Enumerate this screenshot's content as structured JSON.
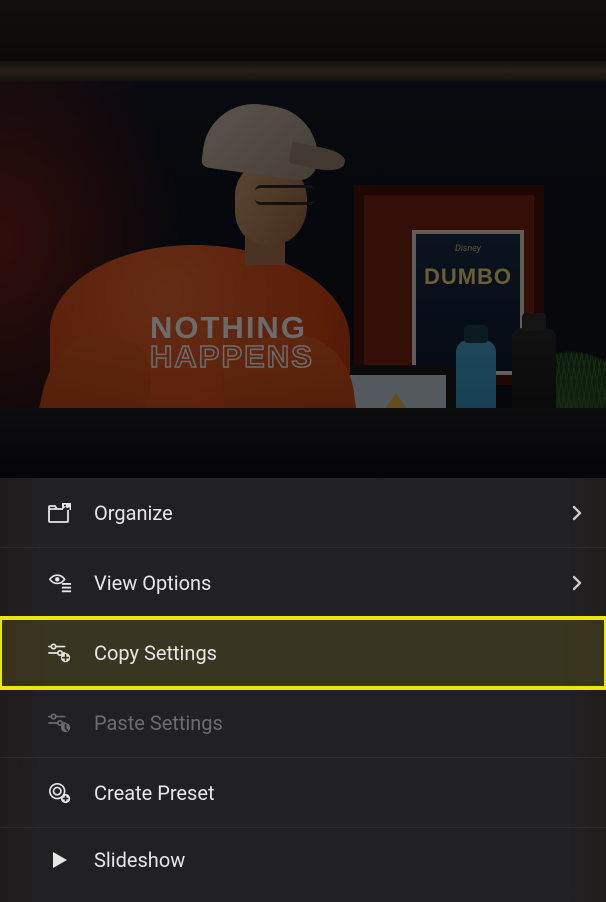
{
  "photo": {
    "sweater_line1": "NOTHING",
    "sweater_line2": "HAPPENS",
    "poster_brand": "Disney",
    "poster_title": "DUMBO"
  },
  "menu": {
    "items": [
      {
        "label": "Organize",
        "has_chevron": true,
        "disabled": false,
        "highlighted": false,
        "icon": "organize-icon"
      },
      {
        "label": "View Options",
        "has_chevron": true,
        "disabled": false,
        "highlighted": false,
        "icon": "view-options-icon"
      },
      {
        "label": "Copy Settings",
        "has_chevron": false,
        "disabled": false,
        "highlighted": true,
        "icon": "sliders-add-icon"
      },
      {
        "label": "Paste Settings",
        "has_chevron": false,
        "disabled": true,
        "highlighted": false,
        "icon": "sliders-paste-icon"
      },
      {
        "label": "Create Preset",
        "has_chevron": false,
        "disabled": false,
        "highlighted": false,
        "icon": "preset-add-icon"
      },
      {
        "label": "Slideshow",
        "has_chevron": false,
        "disabled": false,
        "highlighted": false,
        "icon": "play-icon"
      }
    ]
  }
}
